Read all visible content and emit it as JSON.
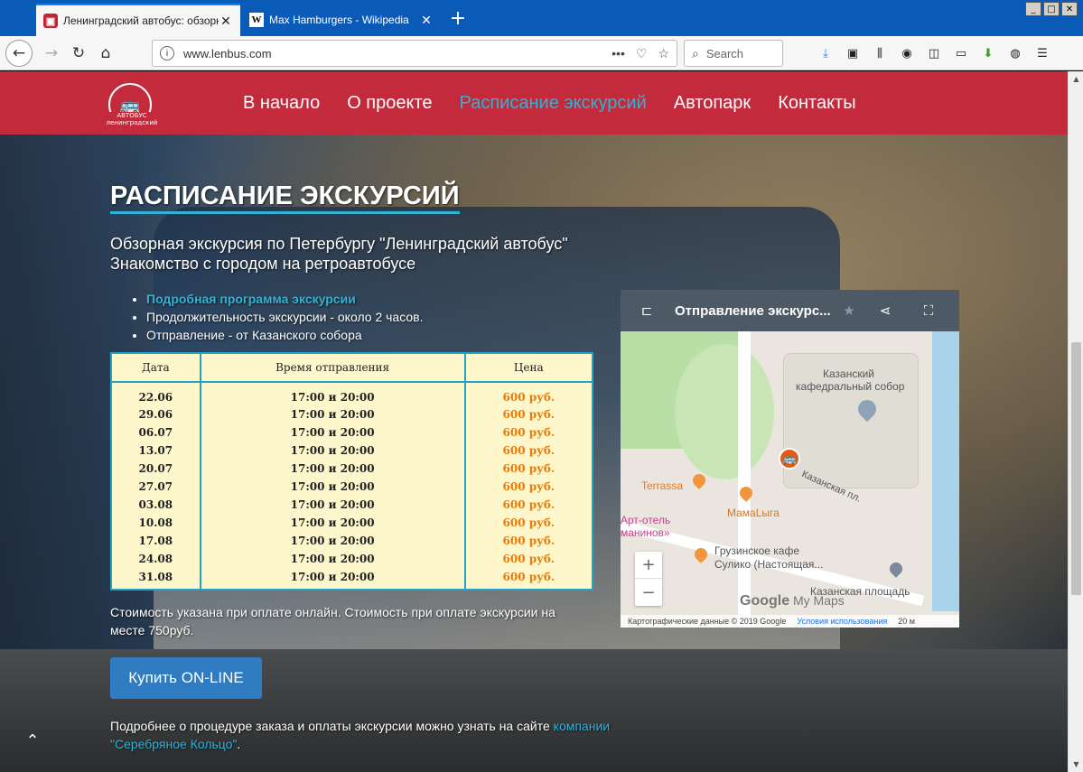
{
  "browser": {
    "tabs": [
      {
        "title": "Ленинградский автобус: обзорн",
        "favicon": "bus-icon",
        "active": true
      },
      {
        "title": "Max Hamburgers - Wikipedia",
        "favicon": "W",
        "active": false
      }
    ],
    "url": "www.lenbus.com",
    "search_placeholder": "Search"
  },
  "site": {
    "logo_text": "АВТОБУС ленинградский",
    "menu": [
      "В начало",
      "О проекте",
      "Расписание экскурсий",
      "Автопарк",
      "Контакты"
    ],
    "active_menu": "Расписание экскурсий"
  },
  "page": {
    "title": "РАСПИСАНИЕ ЭКСКУРСИЙ",
    "subtitle_line1": "Обзорная экскурсия по Петербургу \"Ленинградский автобус\"",
    "subtitle_line2": "Знакомство с городом на ретроавтобусе",
    "bullets": {
      "link": "Подробная программа экскурсии",
      "duration": "Продолжительность экскурсии - около 2 часов.",
      "departure": "Отправление - от Казанского собора"
    },
    "table": {
      "headers": [
        "Дата",
        "Время отправления",
        "Цена"
      ],
      "rows": [
        [
          "22.06",
          "17:00 и 20:00",
          "600 руб."
        ],
        [
          "29.06",
          "17:00 и 20:00",
          "600 руб."
        ],
        [
          "06.07",
          "17:00 и 20:00",
          "600 руб."
        ],
        [
          "13.07",
          "17:00 и 20:00",
          "600 руб."
        ],
        [
          "20.07",
          "17:00 и 20:00",
          "600 руб."
        ],
        [
          "27.07",
          "17:00 и 20:00",
          "600 руб."
        ],
        [
          "03.08",
          "17:00 и 20:00",
          "600 руб."
        ],
        [
          "10.08",
          "17:00 и 20:00",
          "600 руб."
        ],
        [
          "17.08",
          "17:00 и 20:00",
          "600 руб."
        ],
        [
          "24.08",
          "17:00 и 20:00",
          "600 руб."
        ],
        [
          "31.08",
          "17:00 и 20:00",
          "600 руб."
        ]
      ]
    },
    "note": "Стоимость указана при оплате онлайн. Стоимость при оплате экскурсии на месте 750руб.",
    "buy_button": "Купить ON-LINE",
    "more_text": "Подробнее о процедуре заказа и оплаты экскурсии можно узнать на сайте ",
    "more_link": "компании \"Серебряное Кольцо\"",
    "more_end": "."
  },
  "map": {
    "title": "Отправление экскурс...",
    "labels": {
      "cathedral1": "Казанский",
      "cathedral2": "кафедральный собор",
      "terrassa": "Terrassa",
      "mamaliga": "МамаLыга",
      "street": "Казанская пл.",
      "hotel1": "Арт-отель",
      "hotel2": "манинов»",
      "georgian1": "Грузинское кафе",
      "georgian2": "Сулико (Настоящая...",
      "square": "Казанская площадь",
      "google": "Google",
      "mymaps": "My Maps"
    },
    "copyright": "Картографические данные © 2019 Google",
    "terms": "Условия использования",
    "scale": "20 м"
  },
  "colors": {
    "header": "#c32a3c",
    "accent": "#31b3d6",
    "price": "#e87a0a",
    "button": "#2f7cc2"
  }
}
